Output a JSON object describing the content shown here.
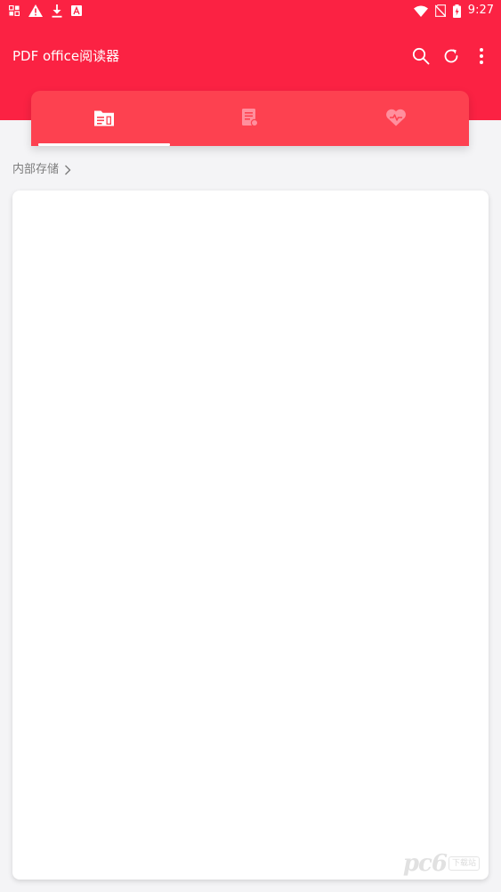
{
  "status_bar": {
    "time": "9:27",
    "left_icons": [
      "notification-icon",
      "warning-icon",
      "download-icon",
      "app-notification-icon"
    ],
    "right_icons": [
      "wifi-icon",
      "no-sim-icon",
      "battery-icon"
    ]
  },
  "toolbar": {
    "title": "PDF office阅读器",
    "actions": [
      "search-icon",
      "refresh-icon",
      "more-vert-icon"
    ]
  },
  "tabs": [
    {
      "icon": "folder-icon",
      "active": true
    },
    {
      "icon": "document-icon",
      "active": false
    },
    {
      "icon": "heart-icon",
      "active": false
    }
  ],
  "breadcrumb": {
    "label": "内部存储",
    "separator_icon": "chevron-right-icon"
  },
  "watermark": {
    "text": "pc6",
    "subtext": "下载站"
  },
  "colors": {
    "primary": "#fb2243",
    "tab_bar": "#fd4150",
    "background": "#f4f4f6",
    "panel": "#ffffff"
  }
}
